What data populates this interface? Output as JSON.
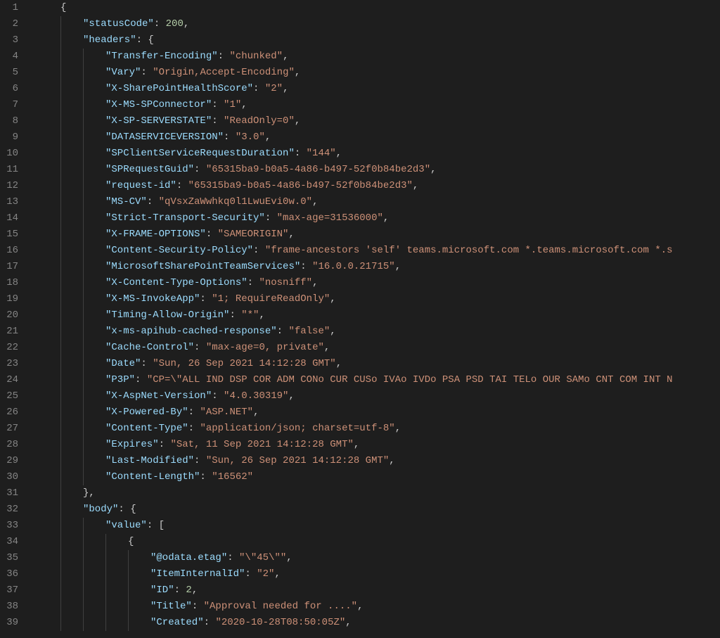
{
  "lines": [
    {
      "n": 1,
      "indent": 1,
      "tokens": [
        {
          "t": "{",
          "c": "brace"
        }
      ]
    },
    {
      "n": 2,
      "indent": 2,
      "tokens": [
        {
          "t": "\"statusCode\"",
          "c": "key"
        },
        {
          "t": ": ",
          "c": "punc"
        },
        {
          "t": "200",
          "c": "num"
        },
        {
          "t": ",",
          "c": "punc"
        }
      ]
    },
    {
      "n": 3,
      "indent": 2,
      "tokens": [
        {
          "t": "\"headers\"",
          "c": "key"
        },
        {
          "t": ": {",
          "c": "punc"
        }
      ]
    },
    {
      "n": 4,
      "indent": 3,
      "tokens": [
        {
          "t": "\"Transfer-Encoding\"",
          "c": "key"
        },
        {
          "t": ": ",
          "c": "punc"
        },
        {
          "t": "\"chunked\"",
          "c": "str"
        },
        {
          "t": ",",
          "c": "punc"
        }
      ]
    },
    {
      "n": 5,
      "indent": 3,
      "tokens": [
        {
          "t": "\"Vary\"",
          "c": "key"
        },
        {
          "t": ": ",
          "c": "punc"
        },
        {
          "t": "\"Origin,Accept-Encoding\"",
          "c": "str"
        },
        {
          "t": ",",
          "c": "punc"
        }
      ]
    },
    {
      "n": 6,
      "indent": 3,
      "tokens": [
        {
          "t": "\"X-SharePointHealthScore\"",
          "c": "key"
        },
        {
          "t": ": ",
          "c": "punc"
        },
        {
          "t": "\"2\"",
          "c": "str"
        },
        {
          "t": ",",
          "c": "punc"
        }
      ]
    },
    {
      "n": 7,
      "indent": 3,
      "tokens": [
        {
          "t": "\"X-MS-SPConnector\"",
          "c": "key"
        },
        {
          "t": ": ",
          "c": "punc"
        },
        {
          "t": "\"1\"",
          "c": "str"
        },
        {
          "t": ",",
          "c": "punc"
        }
      ]
    },
    {
      "n": 8,
      "indent": 3,
      "tokens": [
        {
          "t": "\"X-SP-SERVERSTATE\"",
          "c": "key"
        },
        {
          "t": ": ",
          "c": "punc"
        },
        {
          "t": "\"ReadOnly=0\"",
          "c": "str"
        },
        {
          "t": ",",
          "c": "punc"
        }
      ]
    },
    {
      "n": 9,
      "indent": 3,
      "tokens": [
        {
          "t": "\"DATASERVICEVERSION\"",
          "c": "key"
        },
        {
          "t": ": ",
          "c": "punc"
        },
        {
          "t": "\"3.0\"",
          "c": "str"
        },
        {
          "t": ",",
          "c": "punc"
        }
      ]
    },
    {
      "n": 10,
      "indent": 3,
      "tokens": [
        {
          "t": "\"SPClientServiceRequestDuration\"",
          "c": "key"
        },
        {
          "t": ": ",
          "c": "punc"
        },
        {
          "t": "\"144\"",
          "c": "str"
        },
        {
          "t": ",",
          "c": "punc"
        }
      ]
    },
    {
      "n": 11,
      "indent": 3,
      "tokens": [
        {
          "t": "\"SPRequestGuid\"",
          "c": "key"
        },
        {
          "t": ": ",
          "c": "punc"
        },
        {
          "t": "\"65315ba9-b0a5-4a86-b497-52f0b84be2d3\"",
          "c": "str"
        },
        {
          "t": ",",
          "c": "punc"
        }
      ]
    },
    {
      "n": 12,
      "indent": 3,
      "tokens": [
        {
          "t": "\"request-id\"",
          "c": "key"
        },
        {
          "t": ": ",
          "c": "punc"
        },
        {
          "t": "\"65315ba9-b0a5-4a86-b497-52f0b84be2d3\"",
          "c": "str"
        },
        {
          "t": ",",
          "c": "punc"
        }
      ]
    },
    {
      "n": 13,
      "indent": 3,
      "tokens": [
        {
          "t": "\"MS-CV\"",
          "c": "key"
        },
        {
          "t": ": ",
          "c": "punc"
        },
        {
          "t": "\"qVsxZaWwhkq0l1LwuEvi0w.0\"",
          "c": "str"
        },
        {
          "t": ",",
          "c": "punc"
        }
      ]
    },
    {
      "n": 14,
      "indent": 3,
      "tokens": [
        {
          "t": "\"Strict-Transport-Security\"",
          "c": "key"
        },
        {
          "t": ": ",
          "c": "punc"
        },
        {
          "t": "\"max-age=31536000\"",
          "c": "str"
        },
        {
          "t": ",",
          "c": "punc"
        }
      ]
    },
    {
      "n": 15,
      "indent": 3,
      "tokens": [
        {
          "t": "\"X-FRAME-OPTIONS\"",
          "c": "key"
        },
        {
          "t": ": ",
          "c": "punc"
        },
        {
          "t": "\"SAMEORIGIN\"",
          "c": "str"
        },
        {
          "t": ",",
          "c": "punc"
        }
      ]
    },
    {
      "n": 16,
      "indent": 3,
      "tokens": [
        {
          "t": "\"Content-Security-Policy\"",
          "c": "key"
        },
        {
          "t": ": ",
          "c": "punc"
        },
        {
          "t": "\"frame-ancestors 'self' teams.microsoft.com *.teams.microsoft.com *.s",
          "c": "str"
        }
      ]
    },
    {
      "n": 17,
      "indent": 3,
      "tokens": [
        {
          "t": "\"MicrosoftSharePointTeamServices\"",
          "c": "key"
        },
        {
          "t": ": ",
          "c": "punc"
        },
        {
          "t": "\"16.0.0.21715\"",
          "c": "str"
        },
        {
          "t": ",",
          "c": "punc"
        }
      ]
    },
    {
      "n": 18,
      "indent": 3,
      "tokens": [
        {
          "t": "\"X-Content-Type-Options\"",
          "c": "key"
        },
        {
          "t": ": ",
          "c": "punc"
        },
        {
          "t": "\"nosniff\"",
          "c": "str"
        },
        {
          "t": ",",
          "c": "punc"
        }
      ]
    },
    {
      "n": 19,
      "indent": 3,
      "tokens": [
        {
          "t": "\"X-MS-InvokeApp\"",
          "c": "key"
        },
        {
          "t": ": ",
          "c": "punc"
        },
        {
          "t": "\"1; RequireReadOnly\"",
          "c": "str"
        },
        {
          "t": ",",
          "c": "punc"
        }
      ]
    },
    {
      "n": 20,
      "indent": 3,
      "tokens": [
        {
          "t": "\"Timing-Allow-Origin\"",
          "c": "key"
        },
        {
          "t": ": ",
          "c": "punc"
        },
        {
          "t": "\"*\"",
          "c": "str"
        },
        {
          "t": ",",
          "c": "punc"
        }
      ]
    },
    {
      "n": 21,
      "indent": 3,
      "tokens": [
        {
          "t": "\"x-ms-apihub-cached-response\"",
          "c": "key"
        },
        {
          "t": ": ",
          "c": "punc"
        },
        {
          "t": "\"false\"",
          "c": "str"
        },
        {
          "t": ",",
          "c": "punc"
        }
      ]
    },
    {
      "n": 22,
      "indent": 3,
      "tokens": [
        {
          "t": "\"Cache-Control\"",
          "c": "key"
        },
        {
          "t": ": ",
          "c": "punc"
        },
        {
          "t": "\"max-age=0, private\"",
          "c": "str"
        },
        {
          "t": ",",
          "c": "punc"
        }
      ]
    },
    {
      "n": 23,
      "indent": 3,
      "tokens": [
        {
          "t": "\"Date\"",
          "c": "key"
        },
        {
          "t": ": ",
          "c": "punc"
        },
        {
          "t": "\"Sun, 26 Sep 2021 14:12:28 GMT\"",
          "c": "str"
        },
        {
          "t": ",",
          "c": "punc"
        }
      ]
    },
    {
      "n": 24,
      "indent": 3,
      "tokens": [
        {
          "t": "\"P3P\"",
          "c": "key"
        },
        {
          "t": ": ",
          "c": "punc"
        },
        {
          "t": "\"CP=\\\"ALL IND DSP COR ADM CONo CUR CUSo IVAo IVDo PSA PSD TAI TELo OUR SAMo CNT COM INT N",
          "c": "str"
        }
      ]
    },
    {
      "n": 25,
      "indent": 3,
      "tokens": [
        {
          "t": "\"X-AspNet-Version\"",
          "c": "key"
        },
        {
          "t": ": ",
          "c": "punc"
        },
        {
          "t": "\"4.0.30319\"",
          "c": "str"
        },
        {
          "t": ",",
          "c": "punc"
        }
      ]
    },
    {
      "n": 26,
      "indent": 3,
      "tokens": [
        {
          "t": "\"X-Powered-By\"",
          "c": "key"
        },
        {
          "t": ": ",
          "c": "punc"
        },
        {
          "t": "\"ASP.NET\"",
          "c": "str"
        },
        {
          "t": ",",
          "c": "punc"
        }
      ]
    },
    {
      "n": 27,
      "indent": 3,
      "tokens": [
        {
          "t": "\"Content-Type\"",
          "c": "key"
        },
        {
          "t": ": ",
          "c": "punc"
        },
        {
          "t": "\"application/json; charset=utf-8\"",
          "c": "str"
        },
        {
          "t": ",",
          "c": "punc"
        }
      ]
    },
    {
      "n": 28,
      "indent": 3,
      "tokens": [
        {
          "t": "\"Expires\"",
          "c": "key"
        },
        {
          "t": ": ",
          "c": "punc"
        },
        {
          "t": "\"Sat, 11 Sep 2021 14:12:28 GMT\"",
          "c": "str"
        },
        {
          "t": ",",
          "c": "punc"
        }
      ]
    },
    {
      "n": 29,
      "indent": 3,
      "tokens": [
        {
          "t": "\"Last-Modified\"",
          "c": "key"
        },
        {
          "t": ": ",
          "c": "punc"
        },
        {
          "t": "\"Sun, 26 Sep 2021 14:12:28 GMT\"",
          "c": "str"
        },
        {
          "t": ",",
          "c": "punc"
        }
      ]
    },
    {
      "n": 30,
      "indent": 3,
      "tokens": [
        {
          "t": "\"Content-Length\"",
          "c": "key"
        },
        {
          "t": ": ",
          "c": "punc"
        },
        {
          "t": "\"16562\"",
          "c": "str"
        }
      ]
    },
    {
      "n": 31,
      "indent": 2,
      "tokens": [
        {
          "t": "},",
          "c": "punc"
        }
      ]
    },
    {
      "n": 32,
      "indent": 2,
      "tokens": [
        {
          "t": "\"body\"",
          "c": "key"
        },
        {
          "t": ": {",
          "c": "punc"
        }
      ]
    },
    {
      "n": 33,
      "indent": 3,
      "tokens": [
        {
          "t": "\"value\"",
          "c": "key"
        },
        {
          "t": ": [",
          "c": "punc"
        }
      ]
    },
    {
      "n": 34,
      "indent": 4,
      "tokens": [
        {
          "t": "{",
          "c": "brace"
        }
      ]
    },
    {
      "n": 35,
      "indent": 5,
      "tokens": [
        {
          "t": "\"@odata.etag\"",
          "c": "key"
        },
        {
          "t": ": ",
          "c": "punc"
        },
        {
          "t": "\"\\\"45\\\"\"",
          "c": "str"
        },
        {
          "t": ",",
          "c": "punc"
        }
      ]
    },
    {
      "n": 36,
      "indent": 5,
      "tokens": [
        {
          "t": "\"ItemInternalId\"",
          "c": "key"
        },
        {
          "t": ": ",
          "c": "punc"
        },
        {
          "t": "\"2\"",
          "c": "str"
        },
        {
          "t": ",",
          "c": "punc"
        }
      ]
    },
    {
      "n": 37,
      "indent": 5,
      "tokens": [
        {
          "t": "\"ID\"",
          "c": "key"
        },
        {
          "t": ": ",
          "c": "punc"
        },
        {
          "t": "2",
          "c": "num"
        },
        {
          "t": ",",
          "c": "punc"
        }
      ]
    },
    {
      "n": 38,
      "indent": 5,
      "tokens": [
        {
          "t": "\"Title\"",
          "c": "key"
        },
        {
          "t": ": ",
          "c": "punc"
        },
        {
          "t": "\"Approval needed for ....\"",
          "c": "str"
        },
        {
          "t": ",",
          "c": "punc"
        }
      ]
    },
    {
      "n": 39,
      "indent": 5,
      "tokens": [
        {
          "t": "\"Created\"",
          "c": "key"
        },
        {
          "t": ": ",
          "c": "punc"
        },
        {
          "t": "\"2020-10-28T08:50:05Z\"",
          "c": "str"
        },
        {
          "t": ",",
          "c": "punc"
        }
      ]
    }
  ]
}
